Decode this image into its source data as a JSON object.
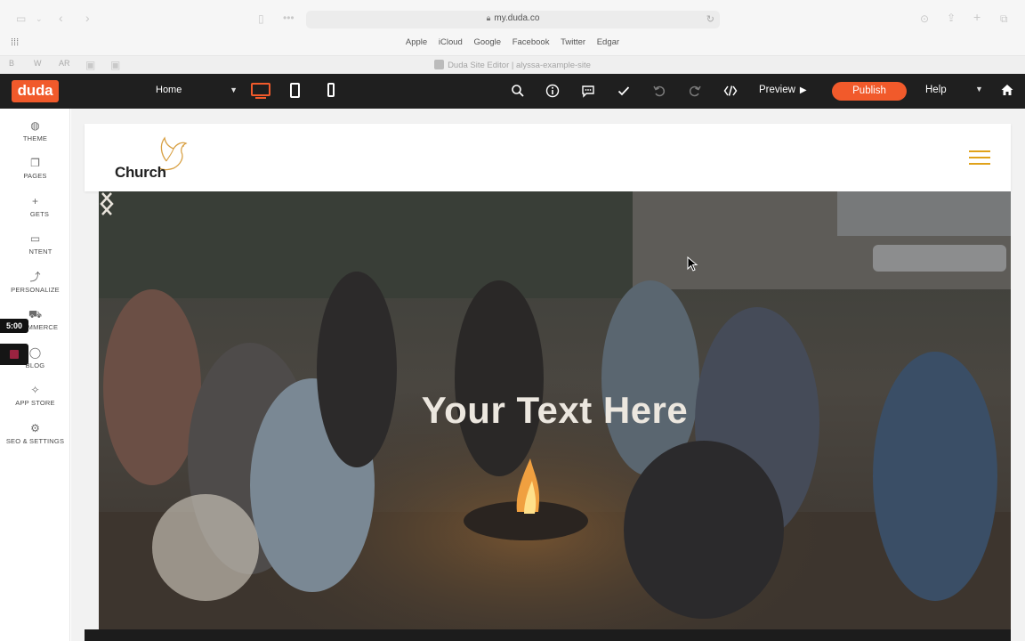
{
  "browser": {
    "url": "my.duda.co",
    "bookmarks": [
      "Apple",
      "iCloud",
      "Google",
      "Facebook",
      "Twitter",
      "Edgar"
    ],
    "tab_title": "Duda Site Editor | alyssa-example-site",
    "extensions": [
      "B",
      "W",
      "AR"
    ]
  },
  "toolbar": {
    "logo": "duda",
    "page_select": "Home",
    "preview_label": "Preview",
    "publish_label": "Publish",
    "help_label": "Help",
    "accent_color": "#f15a2b",
    "icons": [
      "search-icon",
      "info-icon",
      "comment-icon",
      "check-icon",
      "undo-icon",
      "redo-icon",
      "code-icon",
      "home-icon"
    ]
  },
  "sidebar": {
    "items": [
      {
        "label": "THEME",
        "icon": "palette-icon"
      },
      {
        "label": "PAGES",
        "icon": "pages-icon"
      },
      {
        "label": "WIDGETS",
        "display": "GETS",
        "icon": "plus-icon"
      },
      {
        "label": "CONTENT",
        "display": "NTENT",
        "icon": "folder-icon"
      },
      {
        "label": "PERSONALIZE",
        "icon": "personalize-icon"
      },
      {
        "label": "ECOMMERCE",
        "icon": "cart-icon"
      },
      {
        "label": "BLOG",
        "icon": "blog-icon"
      },
      {
        "label": "APP STORE",
        "icon": "app-store-icon"
      },
      {
        "label": "SEO & SETTINGS",
        "icon": "gear-icon"
      }
    ],
    "timer": "5:00"
  },
  "site": {
    "logo_text": "Church",
    "hero_title": "Your Text Here",
    "menu_color": "#e0a21a"
  }
}
